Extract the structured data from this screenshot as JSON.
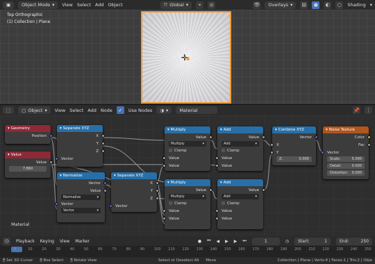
{
  "viewport": {
    "mode": "Object Mode",
    "menu": [
      "View",
      "Select",
      "Add",
      "Object"
    ],
    "orientation": "Global",
    "overlays": "Overlays",
    "shading": "Shading",
    "view_name": "Top Orthographic",
    "collection": "(1) Collection | Plane"
  },
  "node_header": {
    "type": "Object",
    "menu": [
      "View",
      "Select",
      "Add",
      "Node"
    ],
    "use_nodes": "Use Nodes",
    "material": "Material"
  },
  "editor_label": "Material",
  "nodes": {
    "geometry": {
      "title": "Geometry",
      "out": "Position"
    },
    "value": {
      "title": "Value",
      "out": "Value",
      "val": "7.860"
    },
    "sepxyz1": {
      "title": "Separate XYZ",
      "x": "X",
      "y": "Y",
      "z": "Z",
      "in": "Vector"
    },
    "normalize": {
      "title": "Normalize",
      "out1": "Vector",
      "out2": "Value",
      "op": "Normalize",
      "in1": "Vector",
      "in2": "Vector"
    },
    "sepxyz2": {
      "title": "Separate XYZ",
      "x": "X",
      "y": "Y",
      "z": "Z",
      "in": "Vector"
    },
    "mul1": {
      "title": "Multiply",
      "out": "Value",
      "op": "Multiply",
      "clamp": "Clamp",
      "v1": "Value",
      "v2": "Value"
    },
    "mul2": {
      "title": "Multiply",
      "out": "Value",
      "op": "Multiply",
      "clamp": "Clamp",
      "v1": "Value",
      "v2": "Value"
    },
    "add1": {
      "title": "Add",
      "out": "Value",
      "op": "Add",
      "clamp": "Clamp",
      "v1": "Value",
      "v2": "Value"
    },
    "add2": {
      "title": "Add",
      "out": "Value",
      "op": "Add",
      "clamp": "Clamp",
      "v1": "Value",
      "v2": "Value"
    },
    "combxyz": {
      "title": "Combine XYZ",
      "out": "Vector",
      "x": "X",
      "y": "Y",
      "z": "Z:",
      "zval": "0.000"
    },
    "noise": {
      "title": "Noise Texture",
      "color": "Color",
      "fac": "Fac",
      "vec": "Vector",
      "scale": "Scale:",
      "scale_v": "5.000",
      "detail": "Detail:",
      "detail_v": "0.000",
      "distortion": "Distortion:",
      "distortion_v": "0.000"
    }
  },
  "timeline": {
    "menu": [
      "Playback",
      "Keying",
      "View",
      "Marker"
    ],
    "frame": "1",
    "start_label": "Start:",
    "start": "1",
    "end_label": "End:",
    "end": "250",
    "ticks": [
      "0",
      "10",
      "20",
      "30",
      "40",
      "50",
      "60",
      "70",
      "80",
      "90",
      "100",
      "110",
      "120",
      "130",
      "140",
      "150",
      "160",
      "170",
      "180",
      "190",
      "200",
      "210",
      "220",
      "230",
      "240",
      "250"
    ]
  },
  "status": {
    "items": [
      "Set 3D Cursor",
      "Box Select",
      "Rotate View",
      "Select or Deselect All",
      "Move"
    ],
    "info": "Collection | Plane | Verts:4 | Faces:1 | Tris:2 | Obje"
  }
}
